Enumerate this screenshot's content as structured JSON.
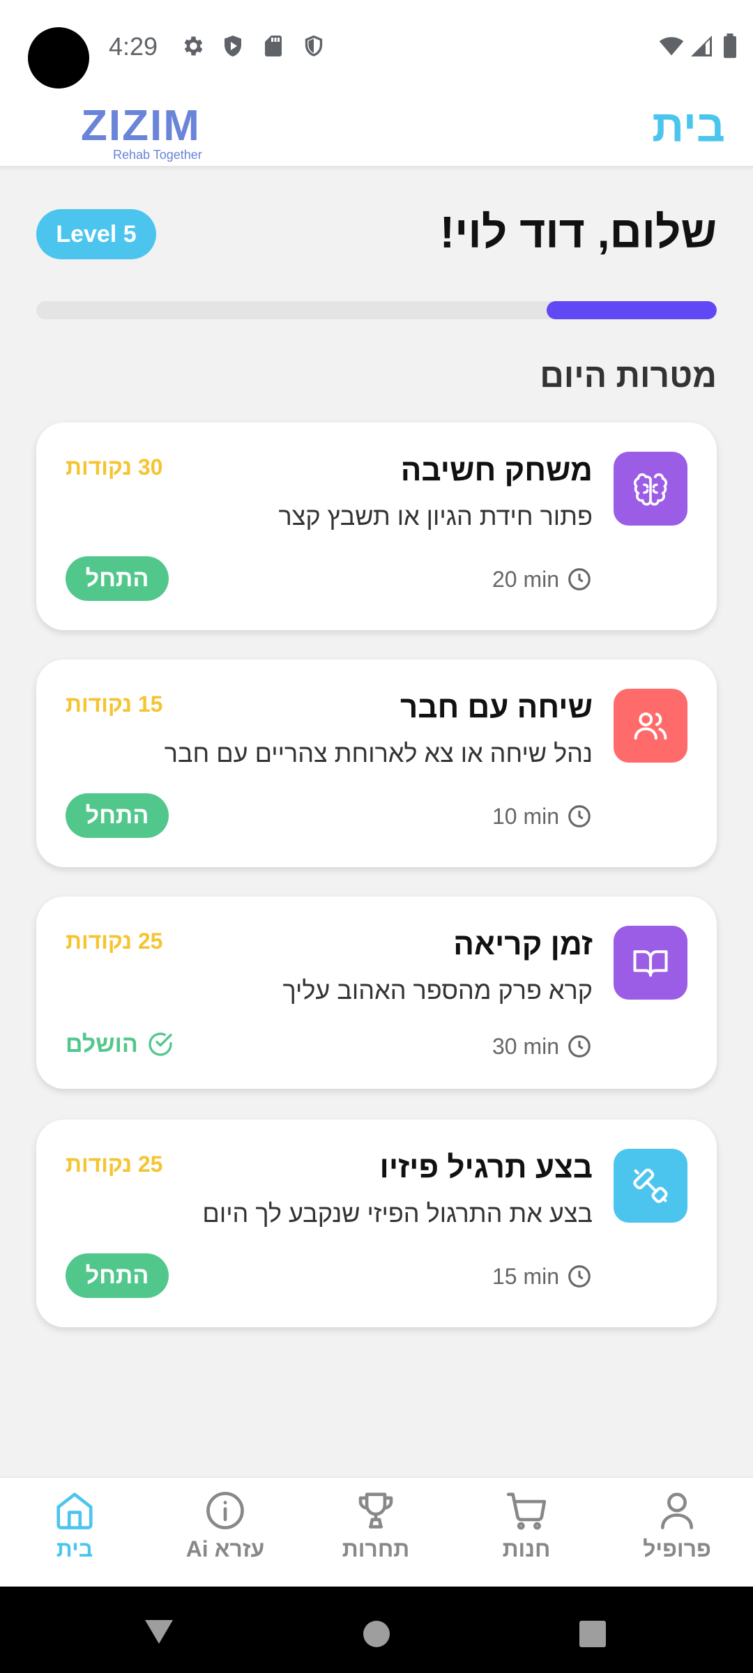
{
  "status_bar": {
    "time": "4:29",
    "icons_left": [
      "gear-icon",
      "shield-play-icon",
      "sd-card-icon",
      "shield-icon"
    ],
    "icons_right": [
      "wifi-icon",
      "signal-icon",
      "battery-icon"
    ]
  },
  "header": {
    "logo_text": "ZIZIM",
    "logo_sub": "Rehab Together",
    "title": "בית",
    "accent_color": "#4cc5ee"
  },
  "greeting": {
    "text": "שלום, דוד לוי!",
    "level": "Level 5",
    "progress_fraction": 0.25,
    "progress_color": "#6048f5"
  },
  "section_title": "מטרות היום",
  "goals": [
    {
      "title": "משחק חשיבה",
      "description": "פתור חידת הגיון או תשבץ קצר",
      "points": "30 נקודות",
      "time": "20 min",
      "icon": "brain-icon",
      "icon_color": "#9b5de5",
      "status": "start",
      "action_label": "התחל"
    },
    {
      "title": "שיחה עם חבר",
      "description": "נהל שיחה או צא לארוחת צהריים עם חבר",
      "points": "15 נקודות",
      "time": "10 min",
      "icon": "users-icon",
      "icon_color": "#ff6b6b",
      "status": "start",
      "action_label": "התחל"
    },
    {
      "title": "זמן קריאה",
      "description": "קרא פרק מהספר האהוב עליך",
      "points": "25 נקודות",
      "time": "30 min",
      "icon": "book-icon",
      "icon_color": "#9b5de5",
      "status": "done",
      "action_label": "הושלם"
    },
    {
      "title": "בצע תרגיל פיזיו",
      "description": "בצע את התרגול הפיזי שנקבע לך היום",
      "points": "25 נקודות",
      "time": "15 min",
      "icon": "dumbbell-icon",
      "icon_color": "#4cc5ee",
      "status": "start",
      "action_label": "התחל"
    }
  ],
  "bottom_nav": {
    "items": [
      {
        "label": "בית",
        "icon": "home-icon",
        "active": true
      },
      {
        "label": "עזרא Ai",
        "icon": "info-icon",
        "active": false
      },
      {
        "label": "תחרות",
        "icon": "trophy-icon",
        "active": false
      },
      {
        "label": "חנות",
        "icon": "cart-icon",
        "active": false
      },
      {
        "label": "פרופיל",
        "icon": "user-icon",
        "active": false
      }
    ],
    "active_color": "#4cc5ee",
    "inactive_color": "#888888"
  }
}
